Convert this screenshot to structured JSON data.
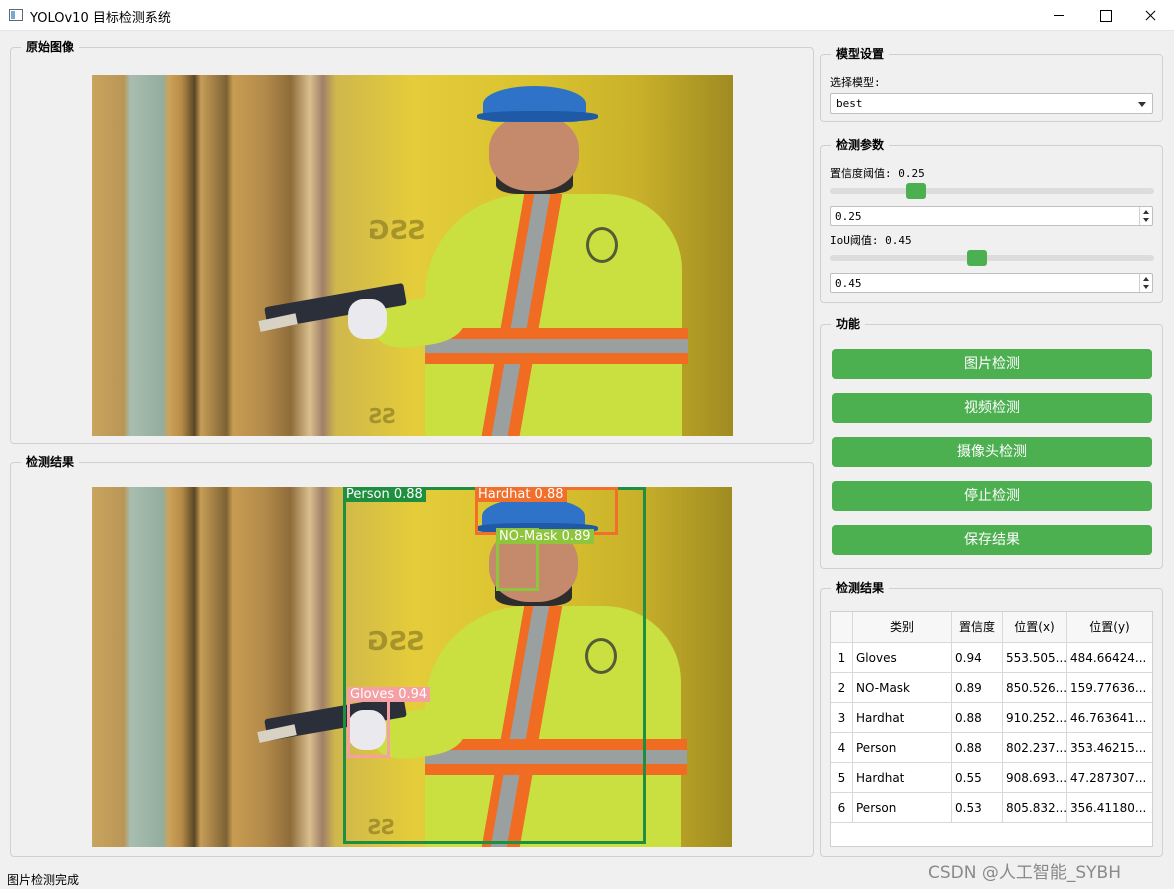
{
  "window": {
    "title": "YOLOv10 目标检测系统"
  },
  "original_panel": {
    "title": "原始图像"
  },
  "result_panel": {
    "title": "检测结果"
  },
  "detections_overlay": [
    {
      "label": "Person 0.88",
      "color": "#1e8f3e"
    },
    {
      "label": "Hardhat 0.88",
      "color": "#f26e2b"
    },
    {
      "label": "NO-Mask 0.89",
      "color": "#8fc53c"
    },
    {
      "label": "Gloves 0.94",
      "color": "#f4a0a4"
    }
  ],
  "model_settings": {
    "title": "模型设置",
    "select_label": "选择模型:",
    "selected_model": "best"
  },
  "params": {
    "title": "检测参数",
    "confidence_label": "置信度阈值: 0.25",
    "confidence_value": "0.25",
    "confidence_fraction": 0.25,
    "iou_label": "IoU阈值: 0.45",
    "iou_value": "0.45",
    "iou_fraction": 0.45
  },
  "functions": {
    "title": "功能",
    "buttons": [
      "图片检测",
      "视频检测",
      "摄像头检测",
      "停止检测",
      "保存结果"
    ]
  },
  "results_table": {
    "title": "检测结果",
    "headers": [
      "类别",
      "置信度",
      "位置(x)",
      "位置(y)"
    ],
    "rows": [
      {
        "num": "1",
        "cls": "Gloves",
        "conf": "0.94",
        "x": "553.505...",
        "y": "484.66424..."
      },
      {
        "num": "2",
        "cls": "NO-Mask",
        "conf": "0.89",
        "x": "850.526...",
        "y": "159.77636..."
      },
      {
        "num": "3",
        "cls": "Hardhat",
        "conf": "0.88",
        "x": "910.252...",
        "y": "46.763641..."
      },
      {
        "num": "4",
        "cls": "Person",
        "conf": "0.88",
        "x": "802.237...",
        "y": "353.46215..."
      },
      {
        "num": "5",
        "cls": "Hardhat",
        "conf": "0.55",
        "x": "908.693...",
        "y": "47.287307..."
      },
      {
        "num": "6",
        "cls": "Person",
        "conf": "0.53",
        "x": "805.832...",
        "y": "356.41180..."
      }
    ]
  },
  "statusbar": {
    "text": "图片检测完成"
  },
  "watermark": {
    "text": "CSDN @人工智能_SYBH"
  },
  "accent_color": "#4caf50"
}
